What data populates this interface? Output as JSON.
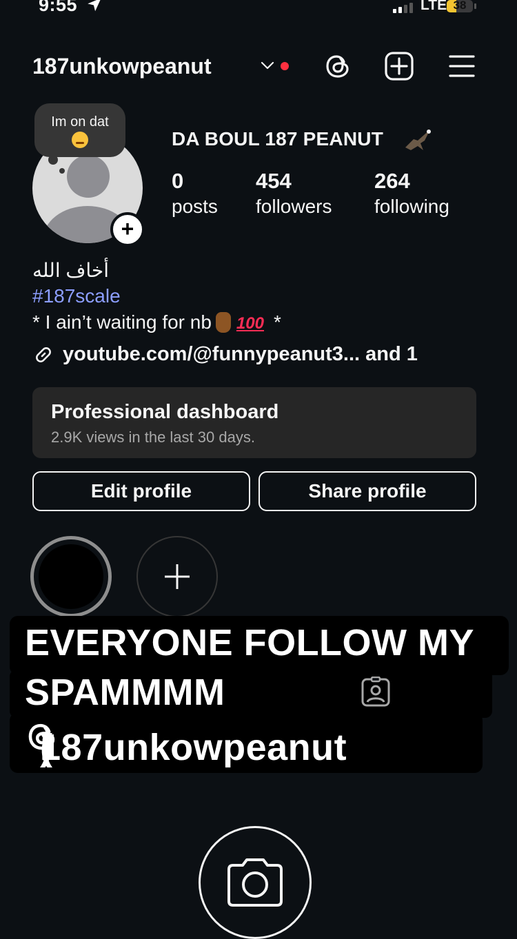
{
  "status_bar": {
    "time": "9:55",
    "network": "LTE",
    "battery_level": 38,
    "battery_text": "38"
  },
  "header": {
    "username": "187unkowpeanut"
  },
  "note": {
    "text": "Im on dat"
  },
  "profile": {
    "display_name": "DA BOUL 187 PEANUT",
    "stats": [
      {
        "value": "0",
        "label": "posts"
      },
      {
        "value": "454",
        "label": "followers"
      },
      {
        "value": "264",
        "label": "following"
      }
    ]
  },
  "bio": {
    "line1": "أخاف الله",
    "hashtag": "#187scale",
    "line3_start": "* I ain’t waiting for nb",
    "line3_100": "100",
    "line3_end": "*",
    "link": "youtube.com/@funnypeanut3...  and 1"
  },
  "dashboard": {
    "title": "Professional dashboard",
    "subtitle": "2.9K views in the last 30 days."
  },
  "buttons": {
    "edit": "Edit profile",
    "share": "Share profile"
  },
  "overlay": {
    "line1": "EVERYONE FOLLOW MY",
    "line2": "SPAMMMM",
    "line3_open": "(",
    "line3_handle": "187unkowpeanut",
    "line3_close": ")"
  },
  "icons": [
    "navigation-arrow-icon",
    "chevron-down-icon",
    "threads-icon",
    "new-post-icon",
    "menu-icon",
    "link-icon",
    "plus-icon",
    "contact-icon",
    "camera-icon"
  ],
  "colors": {
    "background": "#0c1014",
    "accent_link": "#8c9eff",
    "notification_dot": "#ff3040",
    "battery": "#f4c430"
  }
}
